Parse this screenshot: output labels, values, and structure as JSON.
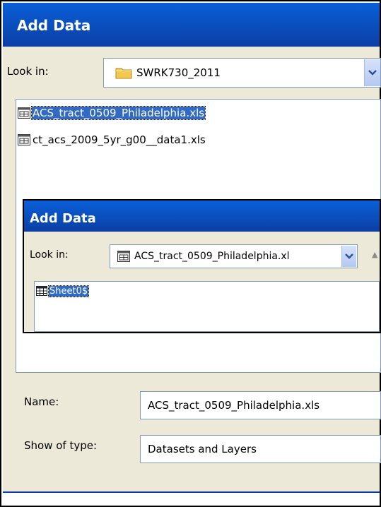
{
  "outer_dialog": {
    "title": "Add Data",
    "look_in_label": "Look in:",
    "look_in_value": "SWRK730_2011",
    "files": [
      {
        "name": "ACS_tract_0509_Philadelphia.xls",
        "selected": true
      },
      {
        "name": "ct_acs_2009_5yr_g00__data1.xls",
        "selected": false
      }
    ],
    "name_label": "Name:",
    "name_value": "ACS_tract_0509_Philadelphia.xls",
    "type_label": "Show of type:",
    "type_value": "Datasets and Layers"
  },
  "inner_dialog": {
    "title": "Add Data",
    "look_in_label": "Look in:",
    "look_in_value": "ACS_tract_0509_Philadelphia.xl",
    "items": [
      {
        "name": "Sheet0$",
        "selected": true
      }
    ]
  },
  "colors": {
    "titlebar": "#0b3fa5",
    "dialog_bg": "#ece9d8",
    "selection": "#316ac5",
    "folder": "#f3c84f"
  }
}
